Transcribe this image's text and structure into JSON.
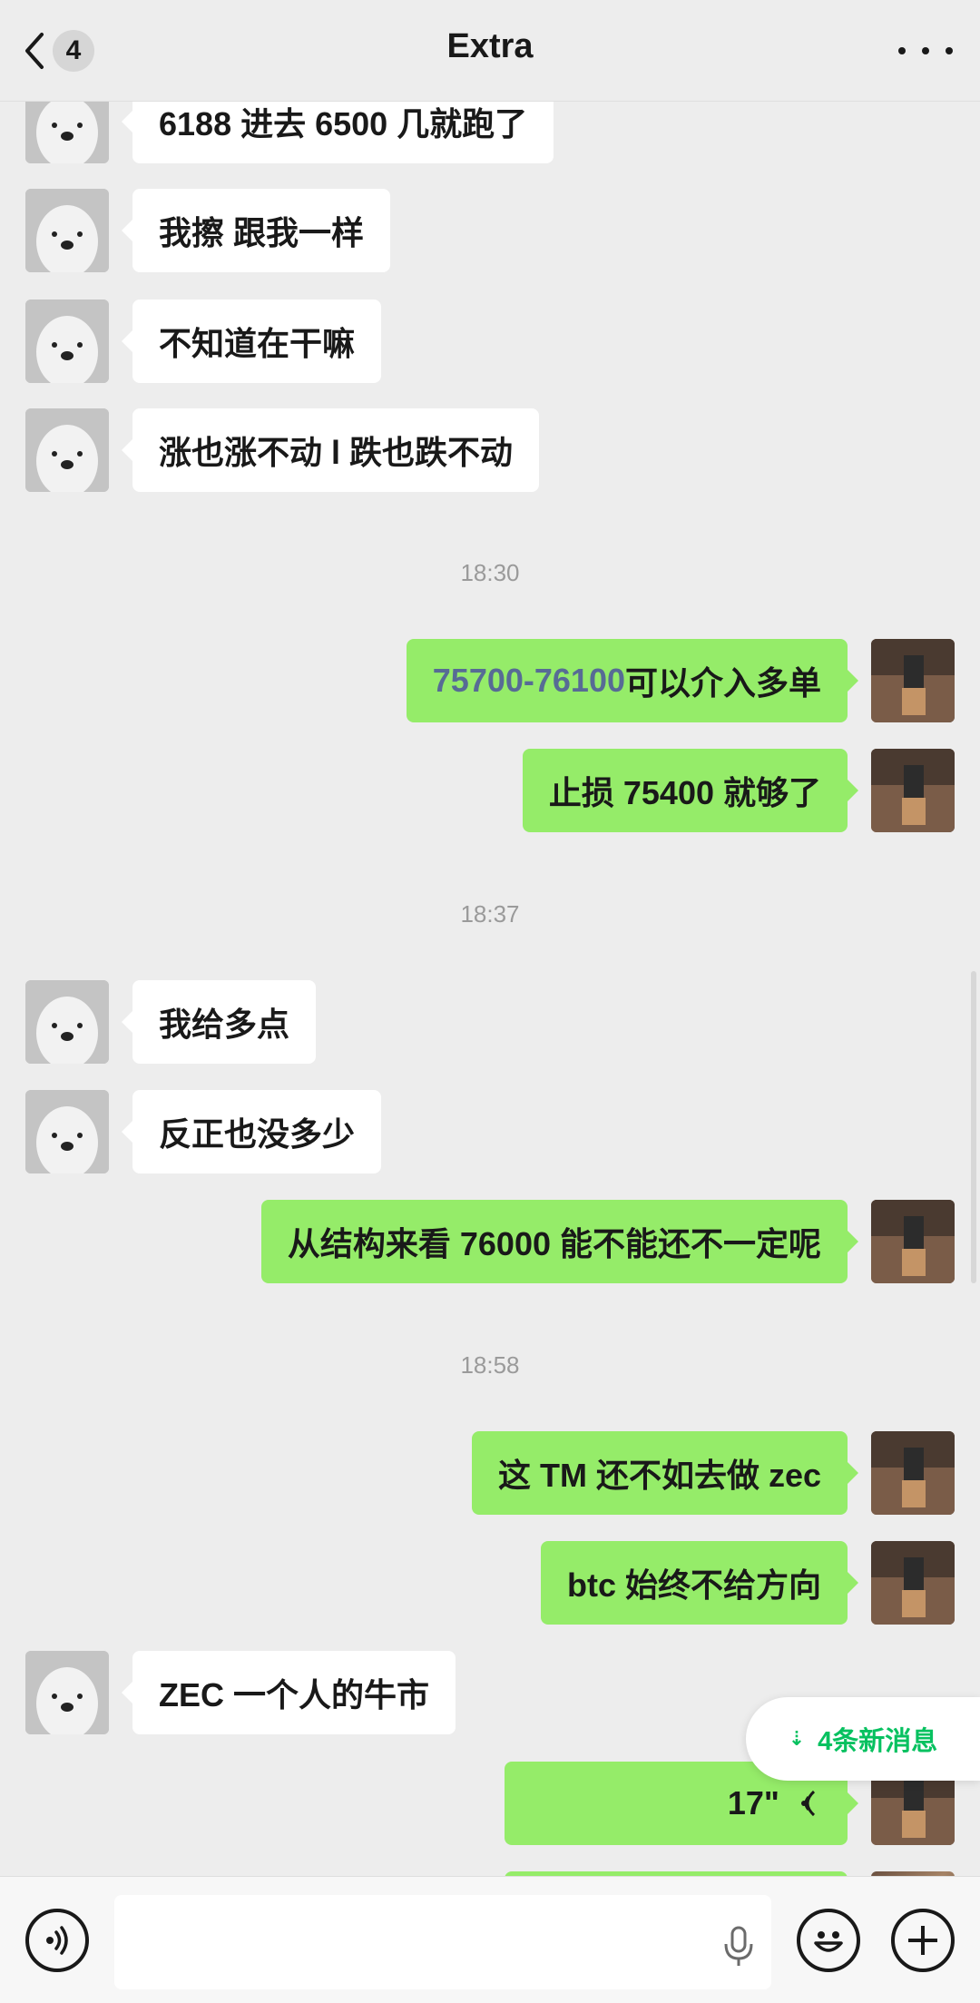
{
  "header": {
    "unread_count": "4",
    "title": "Extra"
  },
  "messages": {
    "m1": "6188 进去  6500 几就跑了",
    "m2": "我擦 跟我一样",
    "m3": "不知道在干嘛",
    "m4": "涨也涨不动 l 跌也跌不动",
    "t1": "18:30",
    "m5_link": "75700-76100",
    "m5_rest": " 可以介入多单",
    "m6": "止损 75400 就够了",
    "t2": "18:37",
    "m7": "我给多点",
    "m8": "反正也没多少",
    "m9": "从结构来看 76000 能不能还不一定呢",
    "t3": "18:58",
    "m10": "这 TM 还不如去做 zec",
    "m11": "btc 始终不给方向",
    "m12": "ZEC 一个人的牛市",
    "m13_voice_duration": "17\""
  },
  "new_messages_label": "4条新消息",
  "icons": {
    "back": "chevron-left-icon",
    "more": "more-dots-icon",
    "voice_mode": "voice-mode-icon",
    "mic": "microphone-icon",
    "emoji": "emoji-icon",
    "plus": "plus-icon"
  },
  "colors": {
    "out_bubble": "#95ec69",
    "in_bubble": "#ffffff",
    "accent": "#07c160",
    "link": "#576b95"
  }
}
